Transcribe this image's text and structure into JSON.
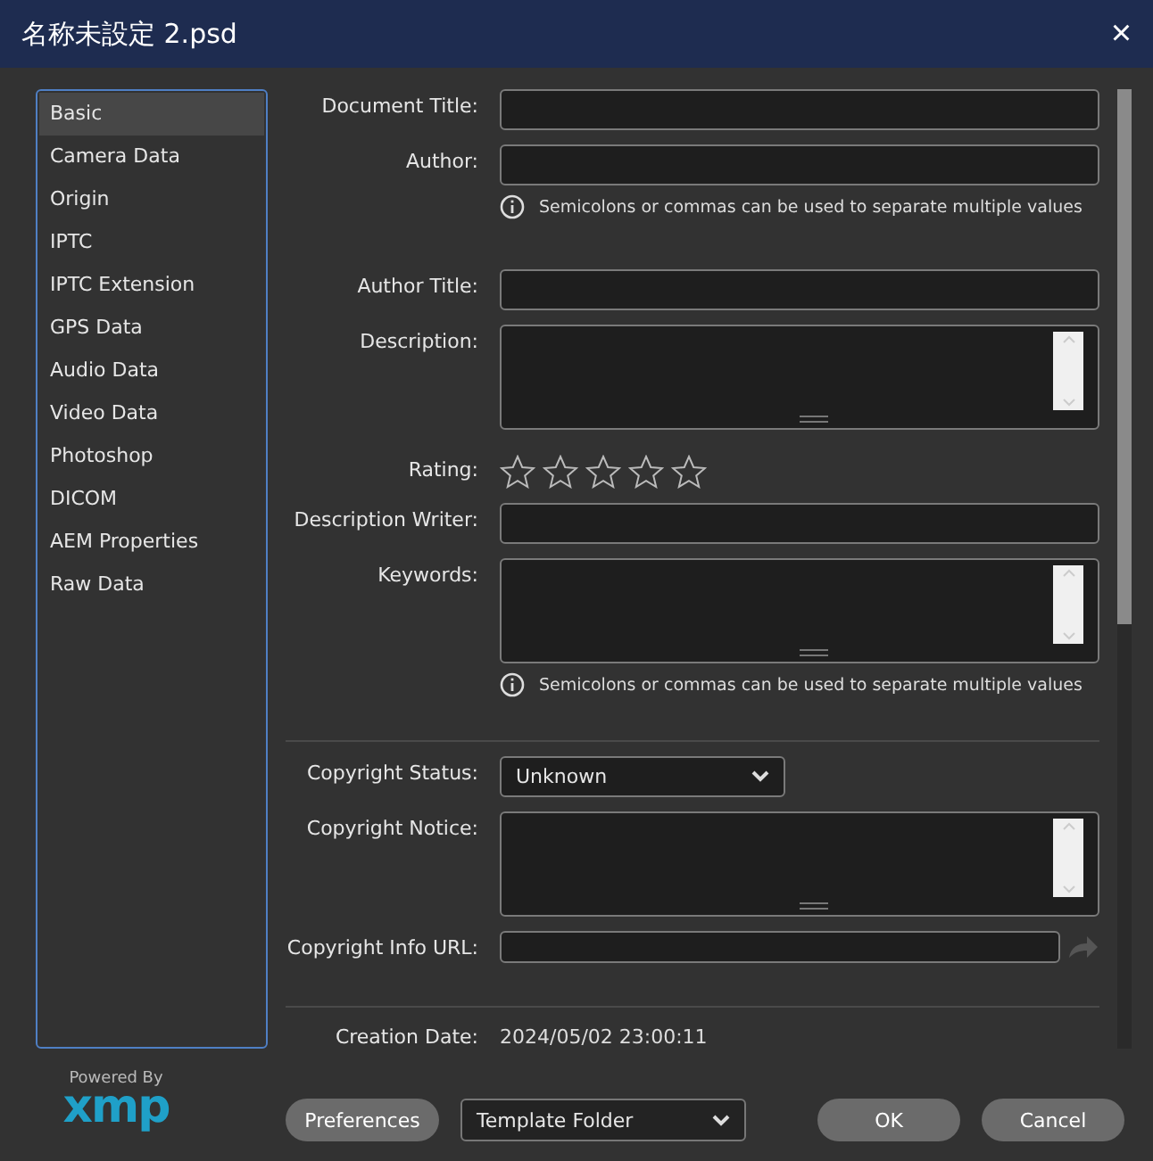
{
  "window": {
    "title": "名称未設定 2.psd",
    "close": "×"
  },
  "sidebar": {
    "items": [
      {
        "label": "Basic",
        "selected": true
      },
      {
        "label": "Camera Data",
        "selected": false
      },
      {
        "label": "Origin",
        "selected": false
      },
      {
        "label": "IPTC",
        "selected": false
      },
      {
        "label": "IPTC Extension",
        "selected": false
      },
      {
        "label": "GPS Data",
        "selected": false
      },
      {
        "label": "Audio Data",
        "selected": false
      },
      {
        "label": "Video Data",
        "selected": false
      },
      {
        "label": "Photoshop",
        "selected": false
      },
      {
        "label": "DICOM",
        "selected": false
      },
      {
        "label": "AEM Properties",
        "selected": false
      },
      {
        "label": "Raw Data",
        "selected": false
      }
    ]
  },
  "form": [
    {
      "kind": "text",
      "label": "Document Title:"
    },
    {
      "kind": "text",
      "label": "Author:"
    },
    {
      "kind": "hint",
      "text": "Semicolons or commas can be used to separate multiple values"
    },
    {
      "kind": "gap"
    },
    {
      "kind": "text",
      "label": "Author Title:"
    },
    {
      "kind": "area",
      "label": "Description:"
    },
    {
      "kind": "rating",
      "label": "Rating:",
      "stars": 0
    },
    {
      "kind": "text",
      "label": "Description Writer:"
    },
    {
      "kind": "area",
      "label": "Keywords:"
    },
    {
      "kind": "hint",
      "text": "Semicolons or commas can be used to separate multiple values"
    },
    {
      "kind": "divider"
    },
    {
      "kind": "select",
      "label": "Copyright Status:",
      "value": "Unknown"
    },
    {
      "kind": "area",
      "label": "Copyright Notice:"
    },
    {
      "kind": "url",
      "label": "Copyright Info URL:"
    },
    {
      "kind": "divider"
    },
    {
      "kind": "static",
      "label": "Creation Date:",
      "value": "2024/05/02 23:00:11"
    }
  ],
  "footer": {
    "powered_by": "Powered By",
    "logo": "xmp",
    "preferences": "Preferences",
    "template": "Template Folder",
    "ok": "OK",
    "cancel": "Cancel"
  }
}
